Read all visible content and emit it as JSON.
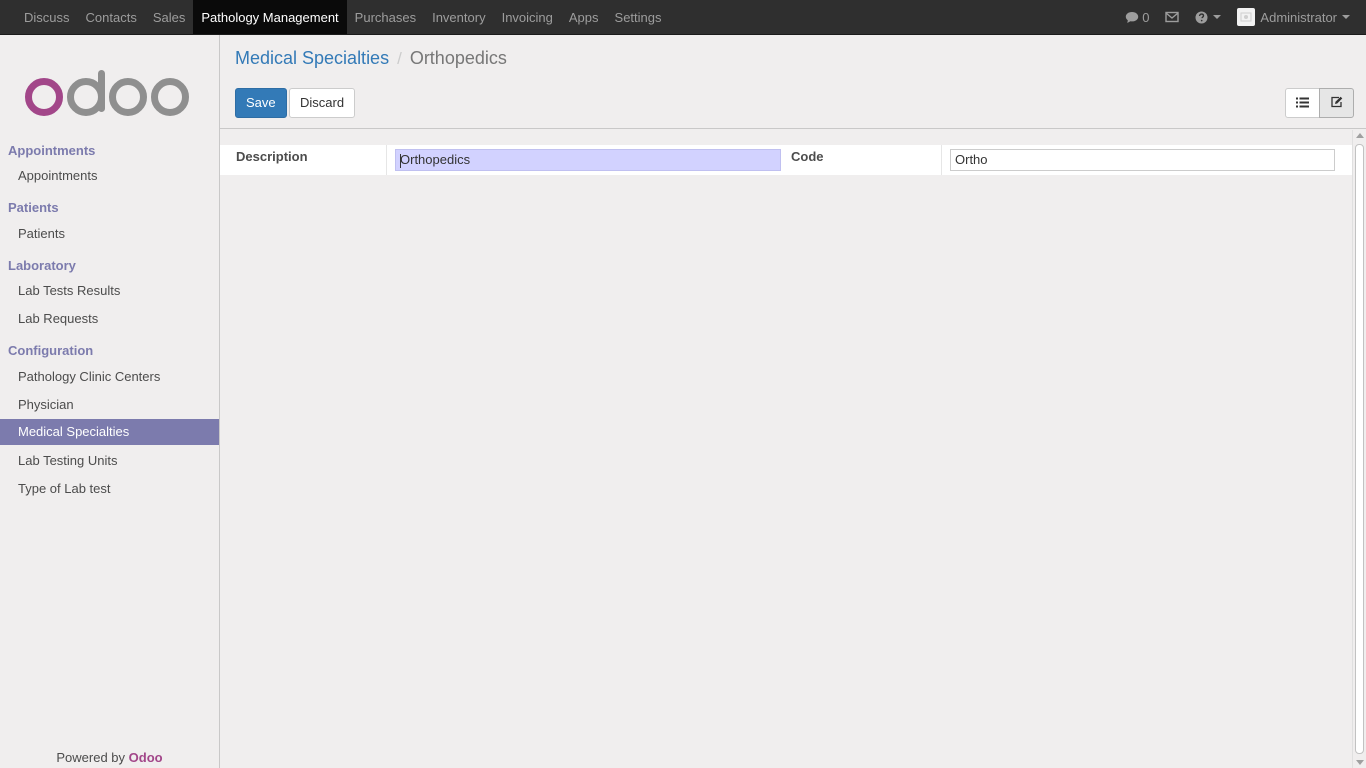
{
  "topbar": {
    "menu": [
      {
        "label": "Discuss"
      },
      {
        "label": "Contacts"
      },
      {
        "label": "Sales"
      },
      {
        "label": "Pathology Management",
        "active": true
      },
      {
        "label": "Purchases"
      },
      {
        "label": "Inventory"
      },
      {
        "label": "Invoicing"
      },
      {
        "label": "Apps"
      },
      {
        "label": "Settings"
      }
    ],
    "chat_count": "0",
    "user": "Administrator"
  },
  "sidebar": {
    "logo_text": "odoo",
    "sections": [
      {
        "title": "Appointments",
        "items": [
          "Appointments"
        ]
      },
      {
        "title": "Patients",
        "items": [
          "Patients"
        ]
      },
      {
        "title": "Laboratory",
        "items": [
          "Lab Tests Results",
          "Lab Requests"
        ]
      },
      {
        "title": "Configuration",
        "items": [
          "Pathology Clinic Centers",
          "Physician",
          "Medical Specialties",
          "Lab Testing Units",
          "Type of Lab test"
        ]
      }
    ],
    "active_item": "Medical Specialties",
    "powered_prefix": "Powered by",
    "powered_brand": "Odoo"
  },
  "breadcrumb": {
    "parent": "Medical Specialties",
    "separator": "/",
    "current": "Orthopedics"
  },
  "buttons": {
    "save": "Save",
    "discard": "Discard"
  },
  "form": {
    "description_label": "Description",
    "description_value": "Orthopedics",
    "code_label": "Code",
    "code_value": "Ortho"
  },
  "colors": {
    "accent": "#7c7bad",
    "brand": "#a24689",
    "primary": "#337ab7"
  }
}
